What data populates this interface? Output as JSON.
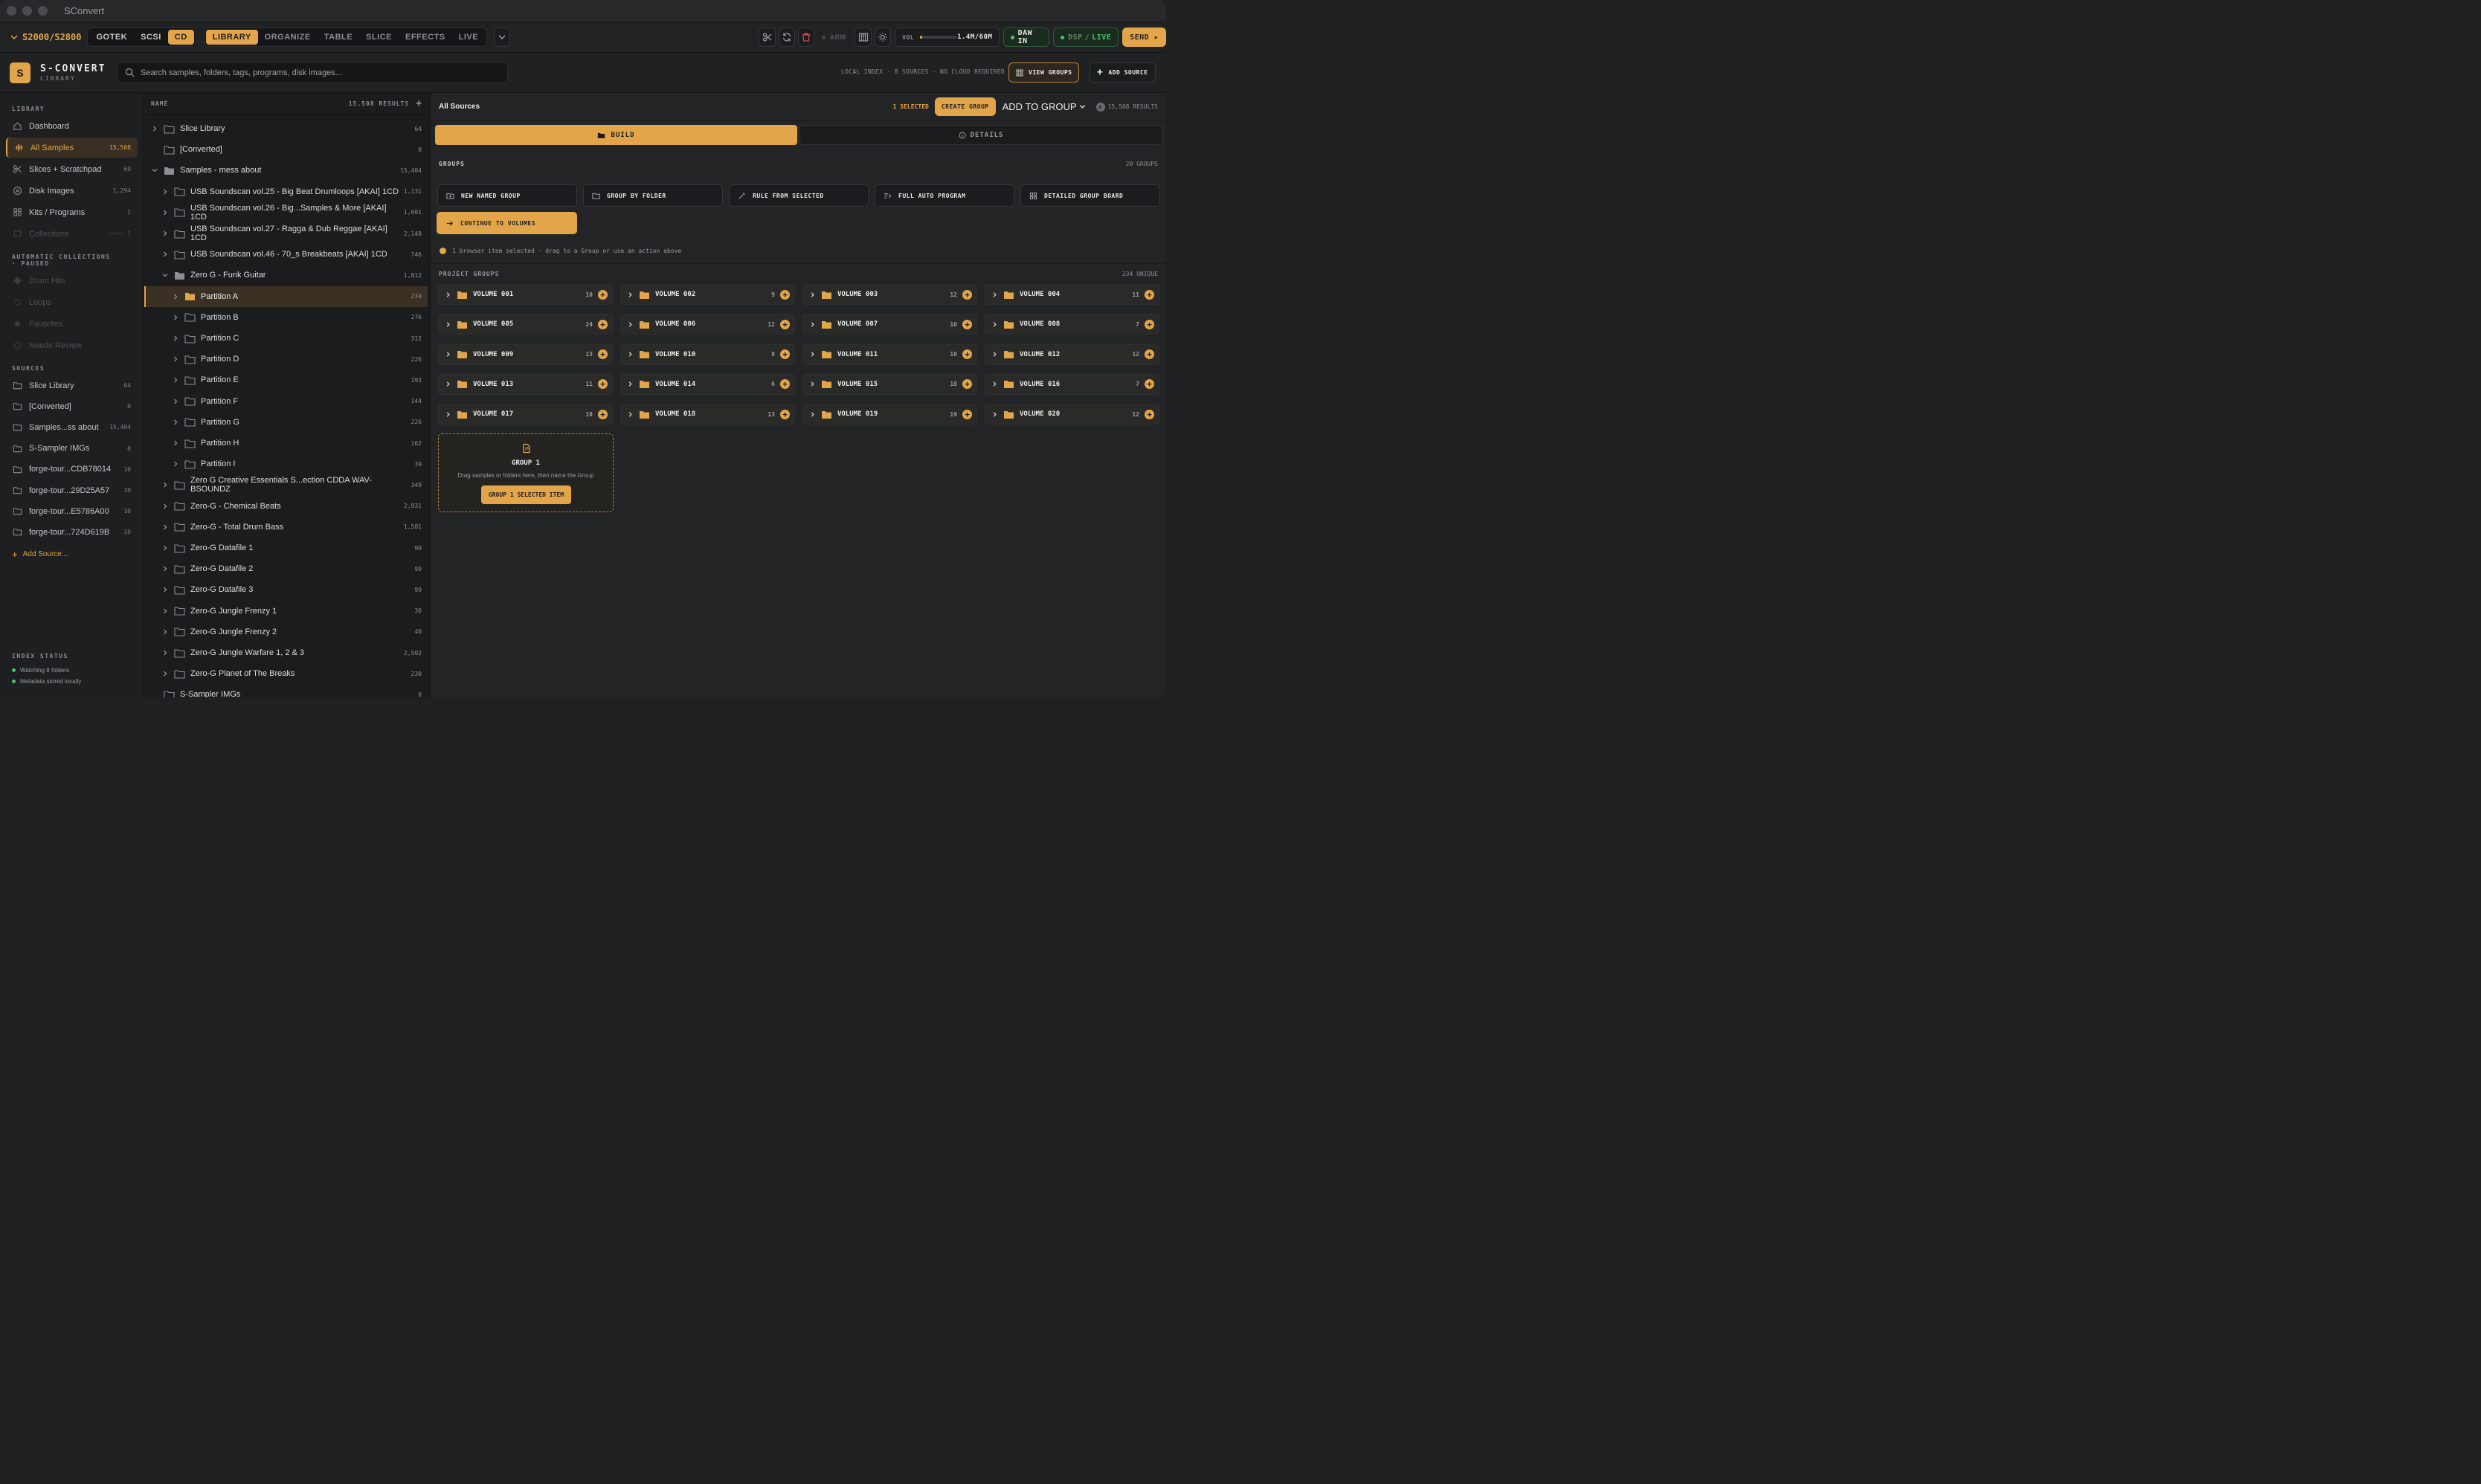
{
  "app": {
    "title": "SConvert"
  },
  "toolbar": {
    "model": "S2000/S2800",
    "media": [
      "GOTEK",
      "SCSI",
      "CD"
    ],
    "active_media": "CD",
    "views": [
      "LIBRARY",
      "ORGANIZE",
      "TABLE",
      "SLICE",
      "EFFECTS",
      "LIVE"
    ],
    "active_view": "LIBRARY",
    "arm": "ARM",
    "vol_label": "VOL",
    "vol_value": "1.4M/60M",
    "vol_fraction": 0.023,
    "daw": "DAW IN",
    "dsp": "DSP",
    "live": "LIVE",
    "send": "SEND ▸"
  },
  "header": {
    "logo": "S",
    "brand": "S-CONVERT",
    "sub": "LIBRARY",
    "search_placeholder": "Search samples, folders, tags, programs, disk images...",
    "info": "LOCAL INDEX · 8 SOURCES · NO CLOUD REQUIRED",
    "view_groups": "VIEW GROUPS",
    "add_source": "ADD SOURCE"
  },
  "sidebar": {
    "library_title": "LIBRARY",
    "library": [
      {
        "label": "Dashboard",
        "count": ""
      },
      {
        "label": "All Samples",
        "count": "15,508"
      },
      {
        "label": "Slices + Scratchpad",
        "count": "69"
      },
      {
        "label": "Disk Images",
        "count": "1,294"
      },
      {
        "label": "Kits / Programs",
        "count": "1"
      },
      {
        "label": "Collections",
        "count": "1",
        "tag": "PAUSED"
      }
    ],
    "auto_title": "AUTOMATIC COLLECTIONS",
    "auto_sub": "· PAUSED",
    "auto": [
      "Drum Hits",
      "Loops",
      "Favorites",
      "Needs Review"
    ],
    "sources_title": "SOURCES",
    "sources": [
      {
        "label": "Slice Library",
        "count": "64"
      },
      {
        "label": "[Converted]",
        "count": "0"
      },
      {
        "label": "Samples...ss about",
        "count": "15,404"
      },
      {
        "label": "S-Sampler IMGs",
        "count": "0"
      },
      {
        "label": "forge-tour...CDB78014",
        "count": "10"
      },
      {
        "label": "forge-tour...29D25A57",
        "count": "10"
      },
      {
        "label": "forge-tour...E5786A00",
        "count": "10"
      },
      {
        "label": "forge-tour...724D619B",
        "count": "10"
      }
    ],
    "add_source": "Add Source...",
    "index_title": "INDEX STATUS",
    "index": [
      "Watching 8 folders",
      "Metadata stored locally"
    ]
  },
  "tree": {
    "col": "NAME",
    "results": "15,508 RESULTS",
    "rows": [
      {
        "d": 0,
        "label": "Slice Library",
        "count": "64",
        "ch": "r"
      },
      {
        "d": 0,
        "label": "[Converted]",
        "count": "0",
        "ch": ""
      },
      {
        "d": 0,
        "label": "Samples - mess about",
        "count": "15,404",
        "ch": "d"
      },
      {
        "d": 1,
        "label": "USB Soundscan vol.25 - Big Beat Drumloops [AKAI] 1CD",
        "count": "1,131",
        "ch": "r"
      },
      {
        "d": 1,
        "label": "USB Soundscan vol.26 - Big...Samples & More [AKAI] 1CD",
        "count": "1,601",
        "ch": "r"
      },
      {
        "d": 1,
        "label": "USB Soundscan vol.27 - Ragga & Dub Reggae [AKAI] 1CD",
        "count": "2,148",
        "ch": "r"
      },
      {
        "d": 1,
        "label": "USB Soundscan vol.46 - 70_s Breakbeats [AKAI] 1CD",
        "count": "746",
        "ch": "r"
      },
      {
        "d": 1,
        "label": "Zero G - Funk Guitar",
        "count": "1,812",
        "ch": "d"
      },
      {
        "d": 2,
        "label": "Partition A",
        "count": "234",
        "ch": "r",
        "sel": true
      },
      {
        "d": 2,
        "label": "Partition B",
        "count": "276",
        "ch": "r"
      },
      {
        "d": 2,
        "label": "Partition C",
        "count": "312",
        "ch": "r"
      },
      {
        "d": 2,
        "label": "Partition D",
        "count": "226",
        "ch": "r"
      },
      {
        "d": 2,
        "label": "Partition E",
        "count": "193",
        "ch": "r"
      },
      {
        "d": 2,
        "label": "Partition F",
        "count": "144",
        "ch": "r"
      },
      {
        "d": 2,
        "label": "Partition G",
        "count": "226",
        "ch": "r"
      },
      {
        "d": 2,
        "label": "Partition H",
        "count": "162",
        "ch": "r"
      },
      {
        "d": 2,
        "label": "Partition I",
        "count": "39",
        "ch": "r"
      },
      {
        "d": 1,
        "label": "Zero G Creative Essentials S...ection CDDA WAV-BSOUNDZ",
        "count": "349",
        "ch": "r"
      },
      {
        "d": 1,
        "label": "Zero-G - Chemical Beats",
        "count": "2,931",
        "ch": "r"
      },
      {
        "d": 1,
        "label": "Zero-G - Total Drum Bass",
        "count": "1,581",
        "ch": "r"
      },
      {
        "d": 1,
        "label": "Zero-G Datafile 1",
        "count": "99",
        "ch": "r"
      },
      {
        "d": 1,
        "label": "Zero-G Datafile 2",
        "count": "99",
        "ch": "r"
      },
      {
        "d": 1,
        "label": "Zero-G Datafile 3",
        "count": "99",
        "ch": "r"
      },
      {
        "d": 1,
        "label": "Zero-G Jungle Frenzy 1",
        "count": "36",
        "ch": "r"
      },
      {
        "d": 1,
        "label": "Zero-G Jungle Frenzy 2",
        "count": "40",
        "ch": "r"
      },
      {
        "d": 1,
        "label": "Zero-G Jungle Warfare 1, 2 & 3",
        "count": "2,502",
        "ch": "r"
      },
      {
        "d": 1,
        "label": "Zero-G Planet of The Breaks",
        "count": "230",
        "ch": "r"
      },
      {
        "d": 0,
        "label": "S-Sampler IMGs",
        "count": "0",
        "ch": ""
      }
    ]
  },
  "main": {
    "title": "All Sources",
    "selected": "1 SELECTED",
    "create_group": "CREATE GROUP",
    "add_to_group": "ADD TO GROUP",
    "results": "15,508 RESULTS",
    "tab_build": "BUILD",
    "tab_details": "DETAILS",
    "groups_title": "GROUPS",
    "groups_count": "20 GROUPS",
    "actions": [
      "NEW NAMED GROUP",
      "GROUP BY FOLDER",
      "RULE FROM SELECTED",
      "FULL AUTO PROGRAM",
      "DETAILED GROUP BOARD"
    ],
    "continue": "CONTINUE TO VOLUMES",
    "hint": "1 browser item selected · drag to a Group or use an action above",
    "project_title": "PROJECT GROUPS",
    "unique": "234 UNIQUE",
    "volumes": [
      {
        "n": "VOLUME 001",
        "c": "10"
      },
      {
        "n": "VOLUME 002",
        "c": "9"
      },
      {
        "n": "VOLUME 003",
        "c": "12"
      },
      {
        "n": "VOLUME 004",
        "c": "11"
      },
      {
        "n": "VOLUME 005",
        "c": "24"
      },
      {
        "n": "VOLUME 006",
        "c": "12"
      },
      {
        "n": "VOLUME 007",
        "c": "10"
      },
      {
        "n": "VOLUME 008",
        "c": "7"
      },
      {
        "n": "VOLUME 009",
        "c": "13"
      },
      {
        "n": "VOLUME 010",
        "c": "8"
      },
      {
        "n": "VOLUME 011",
        "c": "10"
      },
      {
        "n": "VOLUME 012",
        "c": "12"
      },
      {
        "n": "VOLUME 013",
        "c": "11"
      },
      {
        "n": "VOLUME 014",
        "c": "6"
      },
      {
        "n": "VOLUME 015",
        "c": "18"
      },
      {
        "n": "VOLUME 016",
        "c": "7"
      },
      {
        "n": "VOLUME 017",
        "c": "10"
      },
      {
        "n": "VOLUME 018",
        "c": "13"
      },
      {
        "n": "VOLUME 019",
        "c": "19"
      },
      {
        "n": "VOLUME 020",
        "c": "12"
      }
    ],
    "drop_title": "GROUP 1",
    "drop_hint": "Drag samples or folders here, then name the Group",
    "drop_button": "GROUP 1 SELECTED ITEM"
  },
  "colors": {
    "accent": "#e3a54a",
    "bg": "#1e2022",
    "green": "#4cc36a"
  }
}
